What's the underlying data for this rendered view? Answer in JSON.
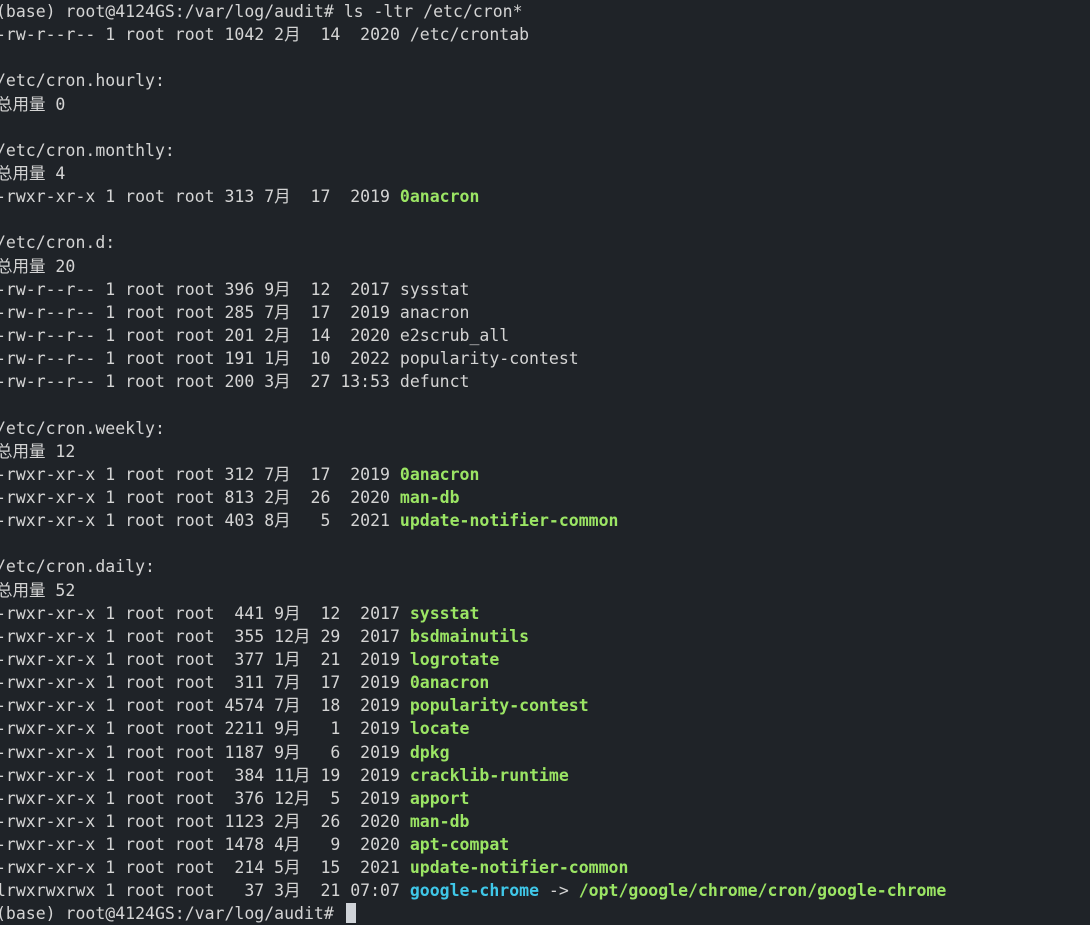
{
  "lines": [
    {
      "type": "prompt",
      "prompt": "(base) root@4124GS:/var/log/audit# ",
      "command": "ls -ltr /etc/cron*"
    },
    {
      "type": "file",
      "meta": "-rw-r--r-- 1 root root 1042 2月  14  2020 ",
      "name": "/etc/crontab",
      "kind": "plain"
    },
    {
      "type": "blank"
    },
    {
      "type": "text",
      "text": "/etc/cron.hourly:"
    },
    {
      "type": "text",
      "text": "总用量 0"
    },
    {
      "type": "blank"
    },
    {
      "type": "text",
      "text": "/etc/cron.monthly:"
    },
    {
      "type": "text",
      "text": "总用量 4"
    },
    {
      "type": "file",
      "meta": "-rwxr-xr-x 1 root root 313 7月  17  2019 ",
      "name": "0anacron",
      "kind": "exec"
    },
    {
      "type": "blank"
    },
    {
      "type": "text",
      "text": "/etc/cron.d:"
    },
    {
      "type": "text",
      "text": "总用量 20"
    },
    {
      "type": "file",
      "meta": "-rw-r--r-- 1 root root 396 9月  12  2017 ",
      "name": "sysstat",
      "kind": "plain"
    },
    {
      "type": "file",
      "meta": "-rw-r--r-- 1 root root 285 7月  17  2019 ",
      "name": "anacron",
      "kind": "plain"
    },
    {
      "type": "file",
      "meta": "-rw-r--r-- 1 root root 201 2月  14  2020 ",
      "name": "e2scrub_all",
      "kind": "plain"
    },
    {
      "type": "file",
      "meta": "-rw-r--r-- 1 root root 191 1月  10  2022 ",
      "name": "popularity-contest",
      "kind": "plain"
    },
    {
      "type": "file",
      "meta": "-rw-r--r-- 1 root root 200 3月  27 13:53 ",
      "name": "defunct",
      "kind": "plain"
    },
    {
      "type": "blank"
    },
    {
      "type": "text",
      "text": "/etc/cron.weekly:"
    },
    {
      "type": "text",
      "text": "总用量 12"
    },
    {
      "type": "file",
      "meta": "-rwxr-xr-x 1 root root 312 7月  17  2019 ",
      "name": "0anacron",
      "kind": "exec"
    },
    {
      "type": "file",
      "meta": "-rwxr-xr-x 1 root root 813 2月  26  2020 ",
      "name": "man-db",
      "kind": "exec"
    },
    {
      "type": "file",
      "meta": "-rwxr-xr-x 1 root root 403 8月   5  2021 ",
      "name": "update-notifier-common",
      "kind": "exec"
    },
    {
      "type": "blank"
    },
    {
      "type": "text",
      "text": "/etc/cron.daily:"
    },
    {
      "type": "text",
      "text": "总用量 52"
    },
    {
      "type": "file",
      "meta": "-rwxr-xr-x 1 root root  441 9月  12  2017 ",
      "name": "sysstat",
      "kind": "exec"
    },
    {
      "type": "file",
      "meta": "-rwxr-xr-x 1 root root  355 12月 29  2017 ",
      "name": "bsdmainutils",
      "kind": "exec"
    },
    {
      "type": "file",
      "meta": "-rwxr-xr-x 1 root root  377 1月  21  2019 ",
      "name": "logrotate",
      "kind": "exec"
    },
    {
      "type": "file",
      "meta": "-rwxr-xr-x 1 root root  311 7月  17  2019 ",
      "name": "0anacron",
      "kind": "exec"
    },
    {
      "type": "file",
      "meta": "-rwxr-xr-x 1 root root 4574 7月  18  2019 ",
      "name": "popularity-contest",
      "kind": "exec"
    },
    {
      "type": "file",
      "meta": "-rwxr-xr-x 1 root root 2211 9月   1  2019 ",
      "name": "locate",
      "kind": "exec"
    },
    {
      "type": "file",
      "meta": "-rwxr-xr-x 1 root root 1187 9月   6  2019 ",
      "name": "dpkg",
      "kind": "exec"
    },
    {
      "type": "file",
      "meta": "-rwxr-xr-x 1 root root  384 11月 19  2019 ",
      "name": "cracklib-runtime",
      "kind": "exec"
    },
    {
      "type": "file",
      "meta": "-rwxr-xr-x 1 root root  376 12月  5  2019 ",
      "name": "apport",
      "kind": "exec"
    },
    {
      "type": "file",
      "meta": "-rwxr-xr-x 1 root root 1123 2月  26  2020 ",
      "name": "man-db",
      "kind": "exec"
    },
    {
      "type": "file",
      "meta": "-rwxr-xr-x 1 root root 1478 4月   9  2020 ",
      "name": "apt-compat",
      "kind": "exec"
    },
    {
      "type": "file",
      "meta": "-rwxr-xr-x 1 root root  214 5月  15  2021 ",
      "name": "update-notifier-common",
      "kind": "exec"
    },
    {
      "type": "file",
      "meta": "lrwxrwxrwx 1 root root   37 3月  21 07:07 ",
      "name": "google-chrome",
      "kind": "link",
      "arrow": " -> ",
      "target": "/opt/google/chrome/cron/google-chrome"
    },
    {
      "type": "prompt",
      "prompt": "(base) root@4124GS:/var/log/audit# ",
      "command": "",
      "cursor": true
    }
  ],
  "colors": {
    "background": "#1f2328",
    "foreground": "#d4d4d4",
    "executable": "#9be564",
    "symlink": "#3fc7e8",
    "cursor": "#cfd3d8"
  }
}
